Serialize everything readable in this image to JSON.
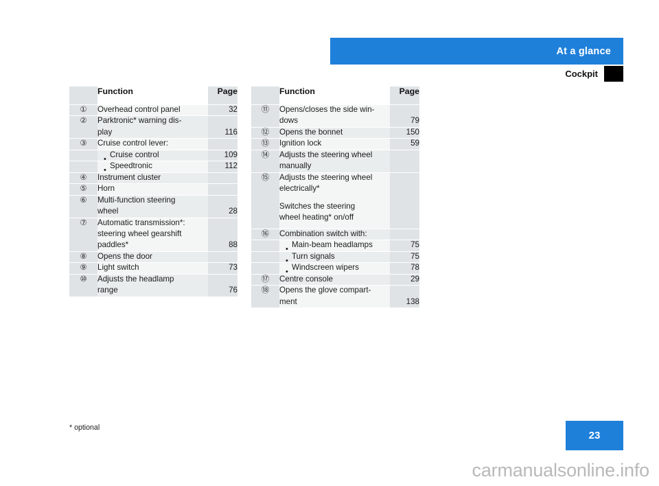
{
  "header": {
    "banner_title": "At a glance",
    "section_title": "Cockpit"
  },
  "columns": {
    "function": "Function",
    "page": "Page"
  },
  "left_table": {
    "rows": [
      {
        "marker": "①",
        "lines": [
          "Overhead control panel"
        ],
        "pages": [
          "32"
        ]
      },
      {
        "marker": "②",
        "lines": [
          "Parktronic* warning dis-",
          "play"
        ],
        "pages": [
          "",
          "116"
        ]
      },
      {
        "marker": "③",
        "lines": [
          "Cruise control lever:"
        ],
        "pages": [
          ""
        ]
      },
      {
        "marker": "",
        "bullet": true,
        "lines": [
          "Cruise control"
        ],
        "pages": [
          "109"
        ]
      },
      {
        "marker": "",
        "bullet": true,
        "lines": [
          "Speedtronic"
        ],
        "pages": [
          "112"
        ]
      },
      {
        "marker": "④",
        "lines": [
          "Instrument cluster"
        ],
        "pages": [
          ""
        ]
      },
      {
        "marker": "⑤",
        "lines": [
          "Horn"
        ],
        "pages": [
          ""
        ]
      },
      {
        "marker": "⑥",
        "lines": [
          "Multi-function steering",
          "wheel"
        ],
        "pages": [
          "",
          "28"
        ]
      },
      {
        "marker": "⑦",
        "lines": [
          "Automatic transmission*:",
          "steering wheel gearshift",
          "paddles*"
        ],
        "pages": [
          "",
          "",
          "88"
        ]
      },
      {
        "marker": "⑧",
        "lines": [
          "Opens the door"
        ],
        "pages": [
          ""
        ]
      },
      {
        "marker": "⑨",
        "lines": [
          "Light switch"
        ],
        "pages": [
          "73"
        ]
      },
      {
        "marker": "⑩",
        "lines": [
          "Adjusts the headlamp",
          "range"
        ],
        "pages": [
          "",
          "76"
        ]
      }
    ]
  },
  "right_table": {
    "rows": [
      {
        "marker": "⑪",
        "lines": [
          "Opens/closes the side win-",
          "dows"
        ],
        "pages": [
          "",
          "79"
        ]
      },
      {
        "marker": "⑫",
        "lines": [
          "Opens the bonnet"
        ],
        "pages": [
          "150"
        ]
      },
      {
        "marker": "⑬",
        "lines": [
          "Ignition lock"
        ],
        "pages": [
          "59"
        ]
      },
      {
        "marker": "⑭",
        "lines": [
          "Adjusts the steering wheel",
          "manually"
        ],
        "pages": [
          "",
          ""
        ]
      },
      {
        "marker": "⑮",
        "lines": [
          "Adjusts the steering wheel",
          "electrically*",
          "",
          "Switches the steering",
          "wheel heating* on/off"
        ],
        "pages": [
          "",
          "",
          "",
          "",
          ""
        ]
      },
      {
        "marker": "⑯",
        "lines": [
          "Combination switch with:"
        ],
        "pages": [
          ""
        ]
      },
      {
        "marker": "",
        "bullet": true,
        "lines": [
          "Main-beam headlamps"
        ],
        "pages": [
          "75"
        ]
      },
      {
        "marker": "",
        "bullet": true,
        "lines": [
          "Turn signals"
        ],
        "pages": [
          "75"
        ]
      },
      {
        "marker": "",
        "bullet": true,
        "lines": [
          "Windscreen wipers"
        ],
        "pages": [
          "78"
        ]
      },
      {
        "marker": "⑰",
        "lines": [
          "Centre console"
        ],
        "pages": [
          "29"
        ]
      },
      {
        "marker": "⑱",
        "lines": [
          "Opens the glove compart-",
          "ment"
        ],
        "pages": [
          "",
          "138"
        ]
      }
    ]
  },
  "footer": {
    "footnote": "* optional",
    "page_number": "23",
    "watermark": "carmanualsonline.info"
  },
  "colors": {
    "brand_blue": "#1f80da",
    "column_gray": "#dfe3e5",
    "row_light": "#f4f6f6",
    "row_dark": "#e9edee",
    "tab_black": "#000000"
  }
}
